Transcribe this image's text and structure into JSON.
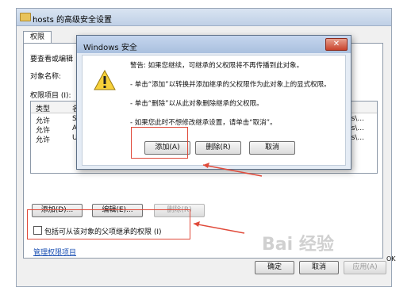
{
  "outer_window": {
    "title": "hosts 的高级安全设置",
    "tab_label": "权限",
    "instruction_text": "要查看或编辑",
    "object_name_label": "对象名称:",
    "perm_items_label": "权限项目 (I):",
    "list_headers": [
      "类型",
      "名"
    ],
    "rows": [
      {
        "type": "允许",
        "name": "SY",
        "tail": "rs\\..."
      },
      {
        "type": "允许",
        "name": "Ad",
        "tail": "rs\\..."
      },
      {
        "type": "允许",
        "name": "Us",
        "tail": "rs\\..."
      }
    ],
    "buttons": {
      "add": "添加(D)...",
      "edit": "编辑(E)...",
      "remove": "删除(R)"
    },
    "inherit_checkbox_label": "包括可从该对象的父项继承的权限 (I)",
    "manage_link": "管理权限项目",
    "footer": {
      "ok": "确定",
      "cancel": "取消",
      "apply": "应用(A)"
    }
  },
  "dialog": {
    "title": "Windows 安全",
    "close_glyph": "✕",
    "messages": [
      "警告: 如果您继续，可继承的父权限将不再传播到此对象。",
      "- 单击“添加”以转换并添加继承的父权限作为此对象上的显式权限。",
      "- 单击“删除”以从此对象删除继承的父权限。",
      "- 如果您此时不想修改继承设置，请单击“取消”。"
    ],
    "buttons": {
      "add": "添加(A)",
      "delete": "删除(R)",
      "cancel": "取消"
    }
  },
  "watermark_text": "Bai 经验",
  "tray": {
    "label": "OK"
  },
  "colors": {
    "annotation_red": "#e04a3a",
    "link_blue": "#1a4fb3"
  },
  "icons": {
    "warning": "warning-icon",
    "folder": "folder-icon",
    "close": "close-icon"
  }
}
